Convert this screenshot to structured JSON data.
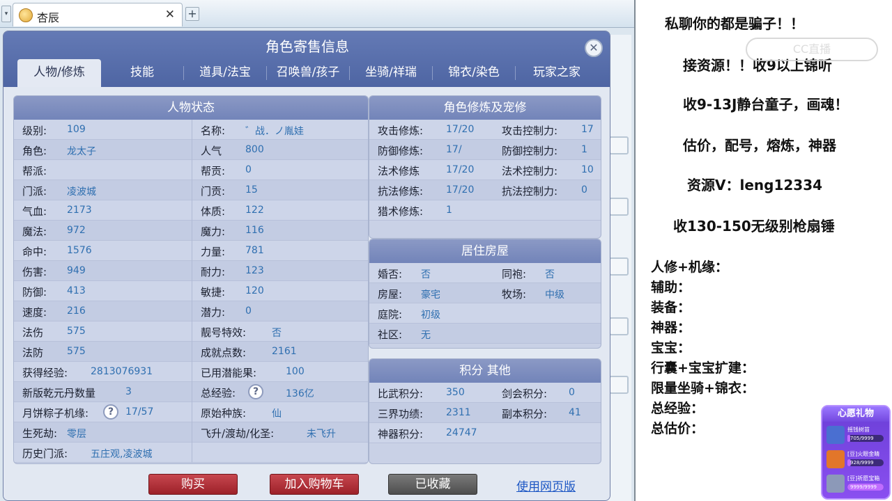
{
  "browser": {
    "tab_title": "杏辰",
    "tab_close": "✕",
    "tab_add": "+",
    "tab_menu": "▾"
  },
  "dialog": {
    "title": "角色寄售信息",
    "close": "✕",
    "tabs": [
      "人物/修炼",
      "技能",
      "道具/法宝",
      "召唤兽/孩子",
      "坐骑/祥瑞",
      "锦衣/染色",
      "玩家之家"
    ],
    "active_tab": 0
  },
  "status": {
    "header": "人物状态",
    "rows": [
      {
        "l1": "级别:",
        "v1": "109",
        "l2": "名称:",
        "v2": "゛战．ノ胤娃"
      },
      {
        "l1": "角色:",
        "v1": "龙太子",
        "l2": "人气",
        "v2": "800"
      },
      {
        "l1": "帮派:",
        "v1": "",
        "l2": "帮贡:",
        "v2": "0"
      },
      {
        "l1": "门派:",
        "v1": "凌波城",
        "l2": "门贡:",
        "v2": "15"
      },
      {
        "l1": "气血:",
        "v1": "2173",
        "l2": "体质:",
        "v2": "122"
      },
      {
        "l1": "魔法:",
        "v1": "972",
        "l2": "魔力:",
        "v2": "116"
      },
      {
        "l1": "命中:",
        "v1": "1576",
        "l2": "力量:",
        "v2": "781"
      },
      {
        "l1": "伤害:",
        "v1": "949",
        "l2": "耐力:",
        "v2": "123"
      },
      {
        "l1": "防御:",
        "v1": "413",
        "l2": "敏捷:",
        "v2": "120"
      },
      {
        "l1": "速度:",
        "v1": "216",
        "l2": "潜力:",
        "v2": "0"
      },
      {
        "l1": "法伤",
        "v1": "575",
        "l2": "靓号特效:",
        "v2": "否"
      },
      {
        "l1": "法防",
        "v1": "575",
        "l2": "成就点数:",
        "v2": "2161"
      },
      {
        "l1": "获得经验:",
        "v1": "2813076931",
        "l2": "已用潜能果:",
        "v2": "100"
      },
      {
        "l1": "新版乾元丹数量",
        "v1": "3",
        "l2": "总经验:",
        "v2": "136亿"
      },
      {
        "l1": "月饼粽子机缘:",
        "v1": "17/57",
        "l2": "原始种族:",
        "v2": "仙"
      },
      {
        "l1": "生死劫:",
        "v1": "零层",
        "l2": "飞升/渡劫/化圣:",
        "v2": "未飞升"
      },
      {
        "l1": "历史门派:",
        "v1": "五庄观,凌波城",
        "l2": "",
        "v2": ""
      }
    ],
    "help_mark": "?"
  },
  "cultivation": {
    "header": "角色修炼及宠修",
    "rows": [
      {
        "l1": "攻击修炼:",
        "v1": "17/20",
        "l2": "攻击控制力:",
        "v2": "17"
      },
      {
        "l1": "防御修炼:",
        "v1": "17/",
        "l2": "防御控制力:",
        "v2": "1"
      },
      {
        "l1": "法术修炼",
        "v1": "17/20",
        "l2": "法术控制力:",
        "v2": "10"
      },
      {
        "l1": "抗法修炼:",
        "v1": "17/20",
        "l2": "抗法控制力:",
        "v2": "0"
      },
      {
        "l1": "猎术修炼:",
        "v1": "1",
        "l2": "",
        "v2": ""
      }
    ]
  },
  "house": {
    "header": "居住房屋",
    "rows": [
      {
        "l1": "婚否:",
        "v1": "否",
        "l2": "同袍:",
        "v2": "否"
      },
      {
        "l1": "房屋:",
        "v1": "豪宅",
        "l2": "牧场:",
        "v2": "中级"
      },
      {
        "l1": "庭院:",
        "v1": "初级",
        "l2": "",
        "v2": ""
      },
      {
        "l1": "社区:",
        "v1": "无",
        "l2": "",
        "v2": ""
      }
    ]
  },
  "points": {
    "header": "积分 其他",
    "rows": [
      {
        "l1": "比武积分:",
        "v1": "350",
        "l2": "剑会积分:",
        "v2": "0"
      },
      {
        "l1": "三界功绩:",
        "v1": "2311",
        "l2": "副本积分:",
        "v2": "41"
      },
      {
        "l1": "神器积分:",
        "v1": "24747",
        "l2": "",
        "v2": ""
      }
    ]
  },
  "buttons": {
    "buy": "购买",
    "add_cart": "加入购物车",
    "favorited": "已收藏",
    "web_version": "使用网页版"
  },
  "overlay": {
    "lines": [
      "私聊你的都是骗子！！",
      "接资源！！收9以上锦听",
      "收9-13J静台童子，画魂！",
      "估价，配号，熔炼，神器",
      "资源V：leng12334",
      "收130-150无级别枪扇锤"
    ],
    "list": [
      "人修+机缘：",
      "辅助：",
      "装备：",
      "神器：",
      "宝宝：",
      "行囊+宝宝扩建：",
      "限量坐骑+锦衣：",
      "总经验：",
      "总估价："
    ],
    "watermark": "CC直播"
  },
  "gift": {
    "title": "心愿礼物",
    "items": [
      {
        "name": "摇钱树苗",
        "count": "705/9999",
        "progress": 0.0705,
        "color": "#4a6fd1"
      },
      {
        "name": "[豆]火眼金睛",
        "count": "928/9999",
        "progress": 0.0928,
        "color": "#e2762a"
      },
      {
        "name": "[豆]祈愿宝箱",
        "count": "9999/9999",
        "progress": 1.0,
        "color": "#8c99b8"
      }
    ]
  }
}
